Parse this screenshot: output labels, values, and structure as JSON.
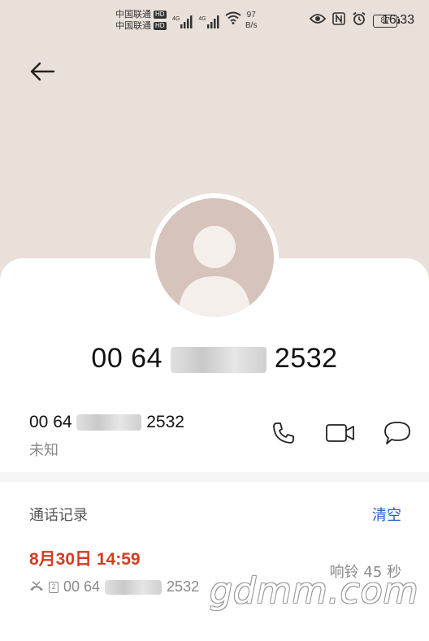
{
  "status_bar": {
    "carrier_1": "中国联通",
    "carrier_2": "中国联通",
    "hd": "HD",
    "net_type": "4G",
    "speed_value": "97",
    "speed_unit": "B/s",
    "battery": "87",
    "time": "16:33"
  },
  "contact": {
    "number_prefix": "00 64",
    "number_suffix": "2532"
  },
  "number_row": {
    "prefix": "00 64",
    "suffix": "2532",
    "type": "未知"
  },
  "call_log": {
    "title": "通话记录",
    "clear_label": "清空",
    "entries": [
      {
        "datetime": "8月30日 14:59",
        "sim": "2",
        "number_prefix": "00 64",
        "number_suffix": "2532",
        "status": "响铃 45 秒"
      }
    ]
  },
  "watermark": "gdmm.com",
  "colors": {
    "header_bg": "#e9e0da",
    "avatar_bg": "#d6c3bb",
    "missed_red": "#d23c20",
    "accent_blue": "#1a5fd0"
  },
  "icons": {
    "back": "arrow-left-icon",
    "call": "phone-icon",
    "video": "video-camera-icon",
    "message": "message-bubble-icon",
    "missed": "missed-call-icon",
    "sim": "sim-2-icon"
  }
}
